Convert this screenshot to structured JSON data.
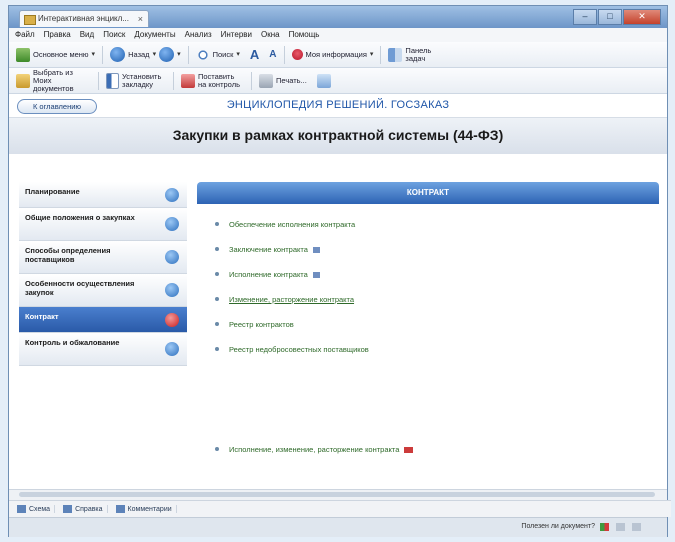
{
  "window": {
    "tab_title": "Интерактивная энцикл...",
    "tab_close": "×",
    "controls": [
      "–",
      "□",
      "✕"
    ]
  },
  "menu": [
    "Файл",
    "Правка",
    "Вид",
    "Поиск",
    "Документы",
    "Анализ",
    "Интерви",
    "Окна",
    "Помощь"
  ],
  "toolbar1": {
    "main_menu": "Основное меню",
    "back": "Назад",
    "search": "Поиск",
    "my_info": "Моя информация",
    "task_panel": "Панель задач"
  },
  "toolbar2": {
    "select_from_list": "Выбрать из Моих документов",
    "set_bookmark": "Установить закладку",
    "put_on_control": "Поставить на контроль",
    "print": "Печать..."
  },
  "back_button": "К оглавлению",
  "encyclopedia_title": "ЭНЦИКЛОПЕДИЯ РЕШЕНИЙ. ГОСЗАКАЗ",
  "page_title": "Закупки в рамках контрактной системы (44-ФЗ)",
  "sidebar": [
    {
      "label": "Планирование"
    },
    {
      "label": "Общие положения о закупках"
    },
    {
      "label": "Способы определения поставщиков"
    },
    {
      "label": "Особенности осуществления закупок"
    },
    {
      "label": "Контракт"
    },
    {
      "label": "Контроль и обжалование"
    }
  ],
  "content_header": "КОНТРАКТ",
  "content_items": [
    {
      "label": "Обеспечение исполнения контракта"
    },
    {
      "label": "Заключение контракта"
    },
    {
      "label": "Исполнение контракта"
    },
    {
      "label": "Изменение, расторжение контракта"
    },
    {
      "label": "Реестр контрактов"
    },
    {
      "label": "Реестр недобросовестных поставщиков"
    },
    {
      "label": "Исполнение, изменение, расторжение контракта"
    }
  ],
  "bottom_tabs": [
    "Схема",
    "Справка",
    "Комментарии"
  ],
  "status": {
    "question": "Полезен ли документ?"
  },
  "colors": {
    "accent": "#2d63b4",
    "link_green": "#2f6a2a",
    "active_dot": "#c91d1d"
  }
}
